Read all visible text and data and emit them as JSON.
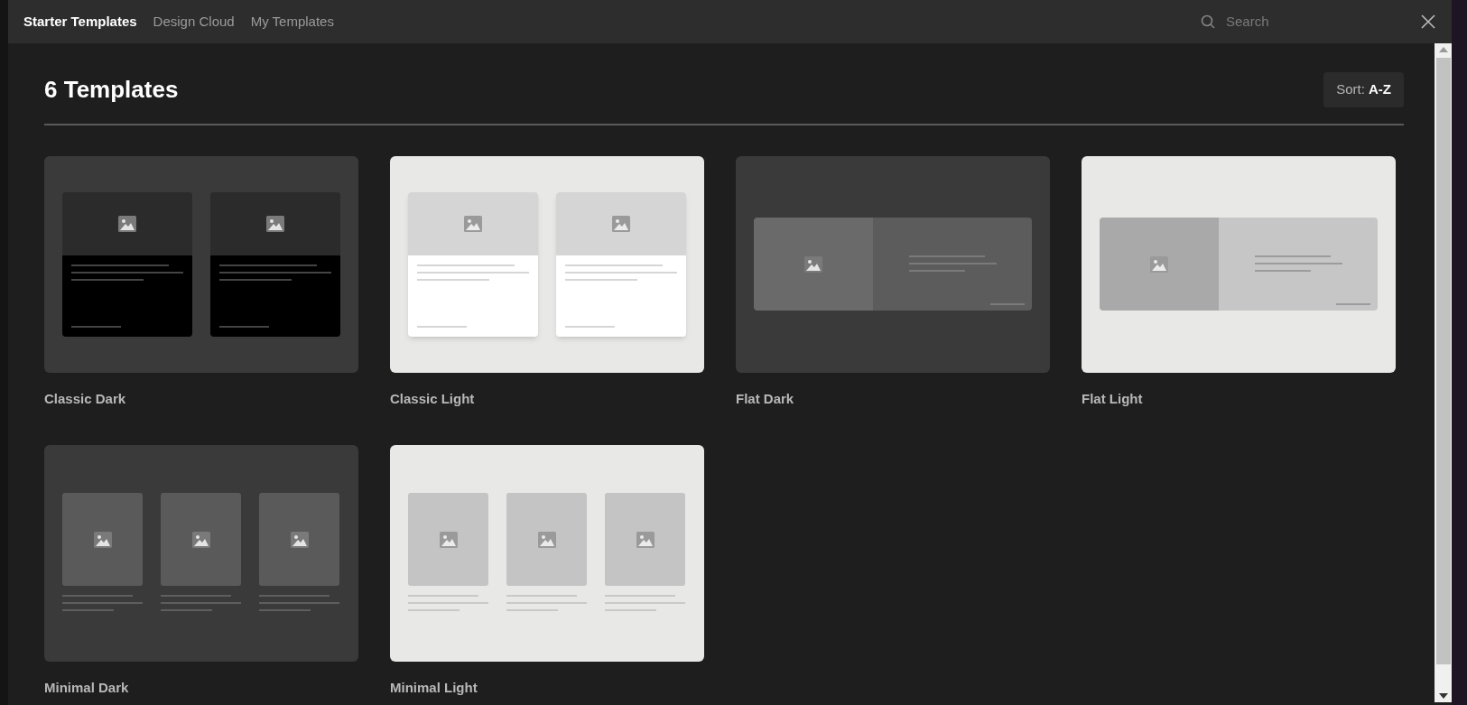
{
  "tabs": [
    {
      "label": "Starter Templates",
      "selected": true
    },
    {
      "label": "Design Cloud",
      "selected": false
    },
    {
      "label": "My Templates",
      "selected": false
    }
  ],
  "search": {
    "placeholder": "Search"
  },
  "heading": "6 Templates",
  "sort": "Sort: **A-Z**",
  "templates": [
    {
      "name": "Classic Dark",
      "kind": "classic",
      "dark": true
    },
    {
      "name": "Classic Light",
      "kind": "classic",
      "dark": false
    },
    {
      "name": "Flat Dark",
      "kind": "flat",
      "dark": true
    },
    {
      "name": "Flat Light",
      "kind": "flat",
      "dark": false
    },
    {
      "name": "Minimal Dark",
      "kind": "minimal",
      "dark": true
    },
    {
      "name": "Minimal Light",
      "kind": "minimal",
      "dark": false
    }
  ]
}
